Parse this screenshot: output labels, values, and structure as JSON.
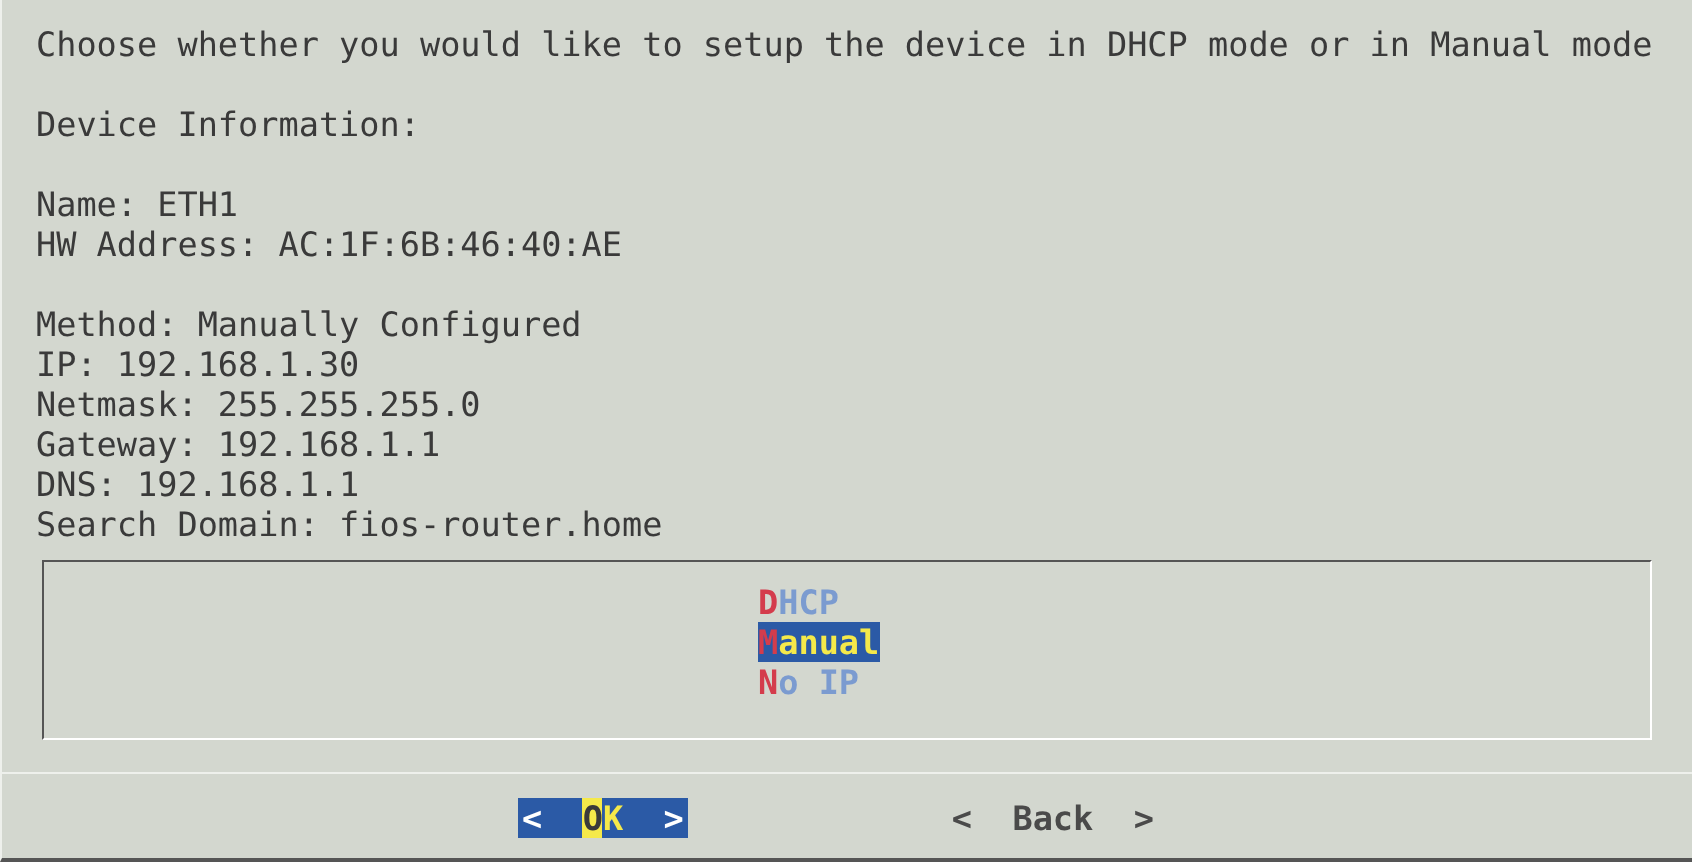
{
  "prompt": "Choose whether you would like to setup the device in DHCP mode or in Manual mode",
  "info_heading": "Device Information:",
  "device": [
    "Name: ETH1",
    "HW Address: AC:1F:6B:46:40:AE"
  ],
  "settings": [
    "Method: Manually Configured",
    "IP: 192.168.1.30",
    "Netmask: 255.255.255.0",
    "Gateway: 192.168.1.1",
    "DNS: 192.168.1.1",
    "Search Domain: fios-router.home"
  ],
  "menu": [
    {
      "label": "DHCP",
      "selected": false
    },
    {
      "label": "Manual",
      "selected": true
    },
    {
      "label": "No IP",
      "selected": false
    }
  ],
  "buttons": [
    {
      "left": "<",
      "label": "OK",
      "right": ">",
      "selected": true
    },
    {
      "left": "<",
      "label": "Back",
      "right": ">",
      "selected": false
    }
  ]
}
